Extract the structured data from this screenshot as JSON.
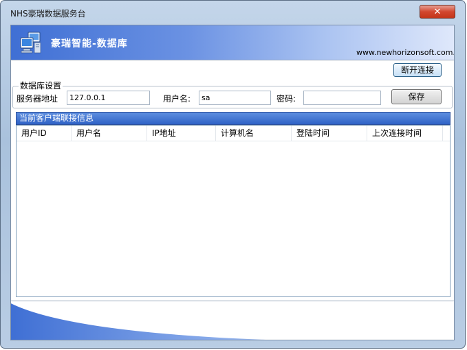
{
  "window": {
    "title": "NHS豪瑞数据服务台"
  },
  "banner": {
    "title": "豪瑞智能-数据库",
    "url": "www.newhorizonsoft.com.cn"
  },
  "toolbar": {
    "disconnect_label": "断开连接"
  },
  "settings": {
    "legend": "数据库设置",
    "server_label": "服务器地址",
    "server_value": "127.0.0.1",
    "user_label": "用户名:",
    "user_value": "sa",
    "password_label": "密码:",
    "password_value": "",
    "save_label": "保存"
  },
  "clients": {
    "header": "当前客户端联接信息",
    "columns": [
      "用户ID",
      "用户名",
      "IP地址",
      "计算机名",
      "登陆时间",
      "上次连接时间"
    ],
    "rows": []
  },
  "colors": {
    "banner_start": "#3f6fd4",
    "header_blue": "#2f62c6",
    "frame": "#a9c1dc"
  },
  "icons": {
    "banner": "computer-network-icon",
    "close": "close-icon"
  }
}
